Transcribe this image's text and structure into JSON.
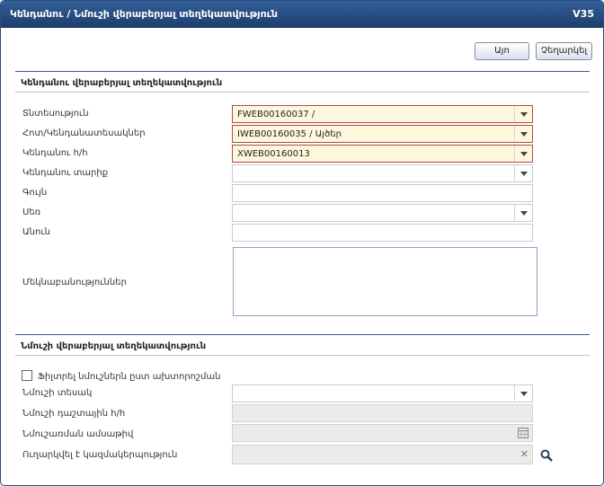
{
  "window": {
    "title": "Կենդանու / Նմուշի վերաբերյալ տեղեկատվություն",
    "code": "V35"
  },
  "toolbar": {
    "ok_label": "Այո",
    "cancel_label": "Չեղարկել"
  },
  "animal_section": {
    "title": "Կենդանու վերաբերյալ տեղեկատվություն",
    "fields": {
      "farm": {
        "label": "Տնտեսություն",
        "value": "FWEB00160037 /"
      },
      "herd": {
        "label": "Հոտ/Կենդանատեսակներ",
        "value": "IWEB00160035 / Այծեր"
      },
      "animal_id": {
        "label": "Կենդանու հ/հ",
        "value": "XWEB00160013"
      },
      "age": {
        "label": "Կենդանու տարիք",
        "value": ""
      },
      "color": {
        "label": "Գույն",
        "value": ""
      },
      "sex": {
        "label": "Սեռ",
        "value": ""
      },
      "name": {
        "label": "Անուն",
        "value": ""
      },
      "notes": {
        "label": "Մեկնաբանություններ",
        "value": ""
      }
    }
  },
  "sample_section": {
    "title": "Նմուշի վերաբերյալ տեղեկատվություն",
    "filter_label": "Ֆիլտրել նմուշներն ըստ ախտորոշման",
    "fields": {
      "sample_type": {
        "label": "Նմուշի տեսակ",
        "value": ""
      },
      "sample_field_no": {
        "label": "Նմուշի դաշտային հ/հ",
        "value": ""
      },
      "sample_date": {
        "label": "Նմուշառման ամսաթիվ",
        "value": ""
      },
      "sent_org": {
        "label": "Ուղարկվել է կազմակերպություն",
        "value": ""
      }
    }
  }
}
